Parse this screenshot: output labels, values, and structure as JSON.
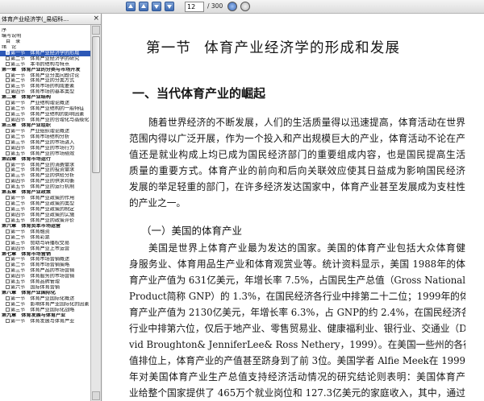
{
  "toolbar": {
    "page_input": "12",
    "page_total": "/ 300"
  },
  "sidebar": {
    "tab_title": "体育产业经济学(_易绍科…",
    "close_glyph": "×",
    "rows": [
      {
        "text": "序",
        "level": 0,
        "icon": false,
        "selected": false,
        "chapter": false
      },
      {
        "text": "编写说明",
        "level": 0,
        "icon": false,
        "selected": false,
        "chapter": false
      },
      {
        "text": "目　录",
        "level": 1,
        "icon": false,
        "selected": false,
        "chapter": false
      },
      {
        "text": "绪　论",
        "level": 0,
        "icon": false,
        "selected": false,
        "chapter": false
      },
      {
        "text": "第一节　体育产业经济学的形成",
        "level": 1,
        "icon": true,
        "selected": true,
        "chapter": false
      },
      {
        "text": "第二节　体育产业经济学的研究",
        "level": 1,
        "icon": true,
        "selected": false,
        "chapter": false
      },
      {
        "text": "第三节　本书的结构与特点",
        "level": 1,
        "icon": true,
        "selected": false,
        "chapter": false
      },
      {
        "text": "第一章　体育产业的分类与市场开发",
        "level": 0,
        "icon": false,
        "selected": false,
        "chapter": true
      },
      {
        "text": "第一节　体育产业分类问题讨论",
        "level": 1,
        "icon": true,
        "selected": false,
        "chapter": false
      },
      {
        "text": "第二节　体育产业的分类方式",
        "level": 1,
        "icon": true,
        "selected": false,
        "chapter": false
      },
      {
        "text": "第三节　体育市场的构成要素",
        "level": 1,
        "icon": true,
        "selected": false,
        "chapter": false
      },
      {
        "text": "第四节　体育市场的基本类型",
        "level": 1,
        "icon": true,
        "selected": false,
        "chapter": false
      },
      {
        "text": "第二章　体育产业结构",
        "level": 0,
        "icon": false,
        "selected": false,
        "chapter": true
      },
      {
        "text": "第一节　产业结构理论概述",
        "level": 1,
        "icon": true,
        "selected": false,
        "chapter": false
      },
      {
        "text": "第二节　体育产业结构的一般特征",
        "level": 1,
        "icon": true,
        "selected": false,
        "chapter": false
      },
      {
        "text": "第三节　体育产业结构的影响因素",
        "level": 1,
        "icon": true,
        "selected": false,
        "chapter": false
      },
      {
        "text": "第四节　体育产业的合理化与高级化",
        "level": 1,
        "icon": true,
        "selected": false,
        "chapter": false
      },
      {
        "text": "第三章　体育产业组织",
        "level": 0,
        "icon": false,
        "selected": false,
        "chapter": true
      },
      {
        "text": "第一节　产业组织理论概述",
        "level": 1,
        "icon": true,
        "selected": false,
        "chapter": false
      },
      {
        "text": "第二节　体育市场结构分析",
        "level": 1,
        "icon": true,
        "selected": false,
        "chapter": false
      },
      {
        "text": "第三节　体育产业的市场进入",
        "level": 1,
        "icon": true,
        "selected": false,
        "chapter": false
      },
      {
        "text": "第四节　体育产业的市场行为",
        "level": 1,
        "icon": true,
        "selected": false,
        "chapter": false
      },
      {
        "text": "第五节　体育产业的市场绩效",
        "level": 1,
        "icon": true,
        "selected": false,
        "chapter": false
      },
      {
        "text": "第四章　体育市场运行",
        "level": 0,
        "icon": false,
        "selected": false,
        "chapter": true
      },
      {
        "text": "第一节　体育产业的消费需求",
        "level": 1,
        "icon": true,
        "selected": false,
        "chapter": false
      },
      {
        "text": "第二节　体育产业的投资需求",
        "level": 1,
        "icon": true,
        "selected": false,
        "chapter": false
      },
      {
        "text": "第三节　体育产业的供给分析",
        "level": 1,
        "icon": true,
        "selected": false,
        "chapter": false
      },
      {
        "text": "第四节　体育产业的供求均衡",
        "level": 1,
        "icon": true,
        "selected": false,
        "chapter": false
      },
      {
        "text": "第五节　体育产业的运行机制",
        "level": 1,
        "icon": true,
        "selected": false,
        "chapter": false
      },
      {
        "text": "第五章　体育产业政策",
        "level": 0,
        "icon": false,
        "selected": false,
        "chapter": true
      },
      {
        "text": "第一节　体育产业政策的作用",
        "level": 1,
        "icon": true,
        "selected": false,
        "chapter": false
      },
      {
        "text": "第二节　体育产业政策的类型",
        "level": 1,
        "icon": true,
        "selected": false,
        "chapter": false
      },
      {
        "text": "第三节　体育产业政策的制定",
        "level": 1,
        "icon": true,
        "selected": false,
        "chapter": false
      },
      {
        "text": "第四节　体育产业政策的实施",
        "level": 1,
        "icon": true,
        "selected": false,
        "chapter": false
      },
      {
        "text": "第五节　体育产业的政策评价",
        "level": 1,
        "icon": true,
        "selected": false,
        "chapter": false
      },
      {
        "text": "第六章　体育资本市场运营",
        "level": 0,
        "icon": false,
        "selected": false,
        "chapter": true
      },
      {
        "text": "第一节　体育融资",
        "level": 1,
        "icon": true,
        "selected": false,
        "chapter": false
      },
      {
        "text": "第二节　体育彩票",
        "level": 1,
        "icon": true,
        "selected": false,
        "chapter": false
      },
      {
        "text": "第三节　赞助与转播权交易",
        "level": 1,
        "icon": true,
        "selected": false,
        "chapter": false
      },
      {
        "text": "第四节　体育产业上市运营",
        "level": 1,
        "icon": true,
        "selected": false,
        "chapter": false
      },
      {
        "text": "第七章　体育市场营销",
        "level": 0,
        "icon": false,
        "selected": false,
        "chapter": true
      },
      {
        "text": "第一节　体育市场营销概述",
        "level": 1,
        "icon": true,
        "selected": false,
        "chapter": false
      },
      {
        "text": "第二节　体育市场营销策略",
        "level": 1,
        "icon": true,
        "selected": false,
        "chapter": false
      },
      {
        "text": "第三节　体育产品的市场营销",
        "level": 1,
        "icon": true,
        "selected": false,
        "chapter": false
      },
      {
        "text": "第四节　体育服务的市场营销",
        "level": 1,
        "icon": true,
        "selected": false,
        "chapter": false
      },
      {
        "text": "第五节　体育品牌管理",
        "level": 1,
        "icon": true,
        "selected": false,
        "chapter": false
      },
      {
        "text": "第六节　国际体育营销",
        "level": 1,
        "icon": true,
        "selected": false,
        "chapter": false
      },
      {
        "text": "第八章　体育产业国际化",
        "level": 0,
        "icon": false,
        "selected": false,
        "chapter": true
      },
      {
        "text": "第一节　体育产业国际化概述",
        "level": 1,
        "icon": true,
        "selected": false,
        "chapter": false
      },
      {
        "text": "第二节　影响体育产业国际化的因素",
        "level": 1,
        "icon": true,
        "selected": false,
        "chapter": false
      },
      {
        "text": "第三节　体育产业国际化战略",
        "level": 1,
        "icon": true,
        "selected": false,
        "chapter": false
      },
      {
        "text": "第九章　体育发展与体育产业",
        "level": 0,
        "icon": false,
        "selected": false,
        "chapter": true
      },
      {
        "text": "第一节　体育发展与体育产业",
        "level": 1,
        "icon": true,
        "selected": false,
        "chapter": false
      }
    ]
  },
  "document": {
    "title_part1": "第一节",
    "title_part2": "体育产业经济学的形成和发展",
    "section_heading": "一、当代体育产业的崛起",
    "paragraph1_lines": [
      "随着世界经济的不断发展，人们的生活质量得以迅速提高，体育活动在世界",
      "范围内得以广泛开展，作为一个投入和产出规模巨大的产业，体育活动不论在产",
      "值还是就业构成上均已成为国民经济部门的重要组成内容，也是国民提高生活",
      "质量的重要方式。体育产业的前向和后向关联效应使其日益成为影响国民经济",
      "发展的举足轻重的部门，在许多经济发达国家中，体育产业甚至发展成为支柱性",
      "的产业之一。"
    ],
    "subheading": "（一）美国的体育产业",
    "paragraph2_lines": [
      "美国是世界上体育产业最为发达的国家。美国的体育产业包括大众体育健",
      "身服务业、体育用品生产业和体育观赏业等。统计资料显示，美国 1988年的体",
      "育产业产值为 631亿美元，年增长率 7.5%，占国民生产总值（Gross National",
      "Product简称 GNP）的 1.3%，在国民经济各行业中排第二十二位；1999年的体",
      "育产业产值为 2130亿美元，年增长率 6.3%，占 GNP的约 2.4%，在国民经济各",
      "行业中排第六位，仅后于地产业、零售贸易业、健康福利业、银行业、交通业（Da-",
      "vid Broughton& JenniferLee& Ross Nethery，1999）。在美国一些州的各行业产",
      "值排位上，体育产业的产值甚至跻身到了前 3位。美国学者 Alfie Meek在 1999",
      "年对美国体育产业生产总值支持经济活动情况的研究结论则表明：美国体育产",
      "业给整个国家提供了 465万个就业岗位和 127.3亿美元的家庭收入，其中，通过"
    ]
  }
}
